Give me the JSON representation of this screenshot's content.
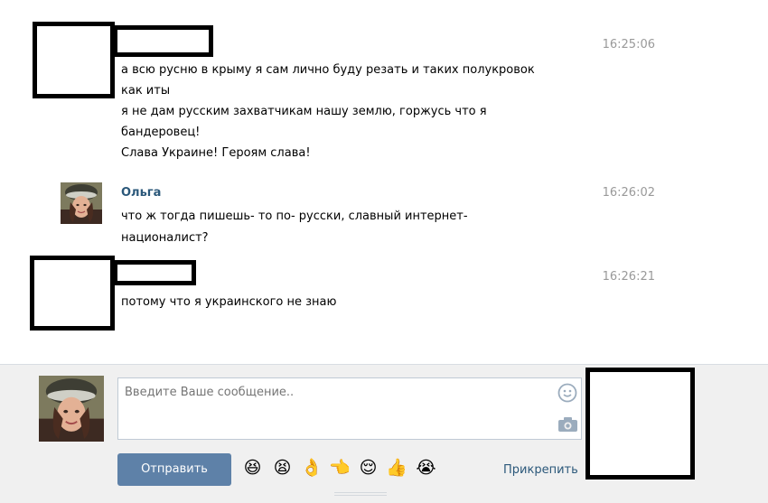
{
  "messages": [
    {
      "time": "16:25:06",
      "lines": [
        "а всю русню в крыму я сам лично буду резать и таких полукровок",
        "как иты",
        "я не дам русским захватчикам нашу землю, горжусь что я",
        "бандеровец!",
        "Слава Украине! Героям слава!"
      ]
    },
    {
      "author": "Ольга",
      "time": "16:26:02",
      "lines": [
        "что ж тогда пишешь- то по- русски, славный интернет-",
        "националист?"
      ]
    },
    {
      "time": "16:26:21",
      "lines": [
        "потому что я украинского не знаю"
      ]
    }
  ],
  "composer": {
    "placeholder": "Введите Ваше сообщение..",
    "send_label": "Отправить",
    "attach_label": "Прикрепить",
    "emoji_icon": "smiley-icon",
    "camera_icon": "camera-icon",
    "emojis": [
      "😆",
      "😫",
      "👌",
      "👈",
      "😌",
      "👍",
      "😭"
    ]
  },
  "colors": {
    "link": "#2b587a",
    "button": "#5e81a8",
    "time": "#999999",
    "composer_bg": "#f0f0f0"
  }
}
